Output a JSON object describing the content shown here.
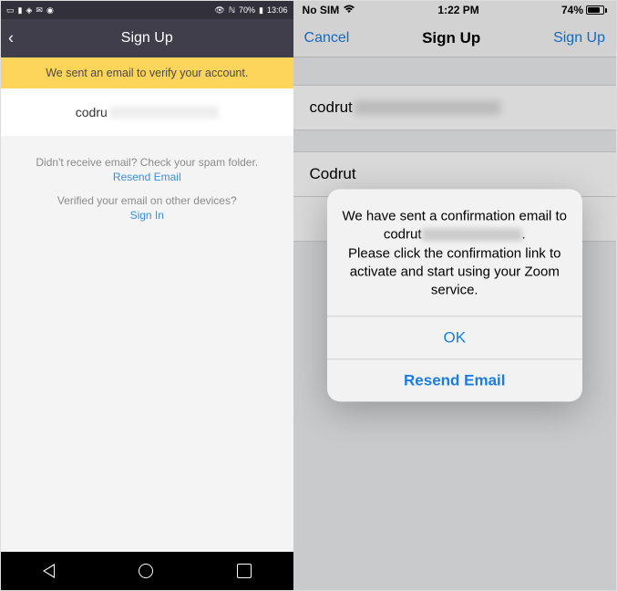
{
  "left": {
    "status": {
      "battery": "70%",
      "time": "13:06"
    },
    "header": {
      "title": "Sign Up"
    },
    "banner": "We sent an email to verify your account.",
    "email_prefix": "codru",
    "help1": "Didn't receive email? Check your spam folder.",
    "resend": "Resend Email",
    "help2": "Verified your email on other devices?",
    "signin": "Sign In"
  },
  "right": {
    "status": {
      "carrier": "No SIM",
      "time": "1:22 PM",
      "battery": "74%"
    },
    "header": {
      "cancel": "Cancel",
      "title": "Sign Up",
      "action": "Sign Up"
    },
    "email_prefix": "codrut",
    "name": "Codrut",
    "alert": {
      "line1": "We have sent a confirmation email to codrut",
      "line2": "Please click the confirmation link to activate and start using your Zoom service.",
      "ok": "OK",
      "resend": "Resend Email"
    }
  }
}
